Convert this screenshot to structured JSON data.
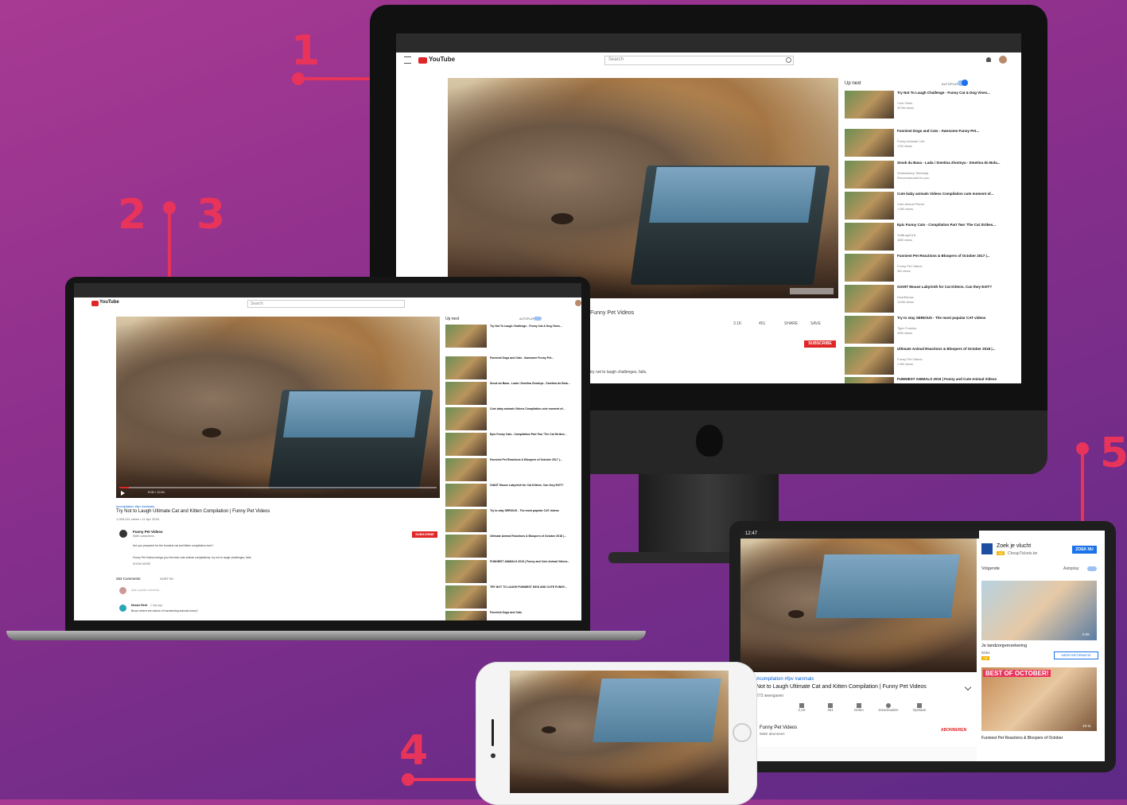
{
  "callouts": [
    {
      "number": "1"
    },
    {
      "number": "2"
    },
    {
      "number": "3"
    },
    {
      "number": "4"
    },
    {
      "number": "5"
    }
  ],
  "desktop": {
    "brand": "YouTube",
    "search_placeholder": "Search",
    "up_next_label": "Up next",
    "autoplay_label": "AUTOPLAY",
    "channel_name": "Funny Pet Videos",
    "subscribe_label": "SUBSCRIBE",
    "share_label": "SHARE",
    "save_label": "SAVE",
    "likes": "3.1K",
    "dislikes": "451",
    "description_snippet": "try not to laugh challenges, fails,",
    "up_next": [
      {
        "title": "Try Not To Laugh Challenge - Funny Cat & Dog Vines...",
        "channel": "Cool Vines",
        "views": "307M views"
      },
      {
        "title": "Funniest Dogs and Cats - Awesome Funny Pet...",
        "channel": "Funny Animals' Life",
        "views": "17M views"
      },
      {
        "title": "Smok du Basa - Lada i Smetina Zivotnya - Smetina do Bola...",
        "channel": "Smetankovy Televizija",
        "views": "Recommended for you"
      },
      {
        "title": "Cute baby animals Videos Compilation cute moment of...",
        "channel": "Cute Animal Planet",
        "views": "1.6M views"
      },
      {
        "title": "Epic Funny Cats - Compilation Part Two 'The Cat Strikes...",
        "channel": "VidBurg2018",
        "views": "18M views"
      },
      {
        "title": "Funniest Pet Reactions & Bloopers of October 2017 |...",
        "channel": "Funny Pet Videos",
        "views": "3M views"
      },
      {
        "title": "GIANT Mouse Labyrinth for Cat Kittens. Can they EXIT?",
        "channel": "DoorMouse",
        "views": "120M views"
      },
      {
        "title": "Try to stay SERIOUS - The most popular CAT videos",
        "channel": "Tiger Funnies",
        "views": "33M views"
      },
      {
        "title": "Ultimate Animal Reactions & Bloopers of October 2018 |...",
        "channel": "Funny Pet Videos",
        "views": "1.6M views"
      },
      {
        "title": "FUNNIEST ANIMALS 2019 | Funny and Cute Animal Videos",
        "channel": "",
        "views": ""
      }
    ]
  },
  "laptop": {
    "brand": "YouTube",
    "search_placeholder": "Search",
    "hashtags": "#compilation #fpv #animals",
    "video_title": "Try Not to Laugh Ultimate Cat and Kitten Compilation | Funny Pet Videos",
    "views_date": "1,099,241 views • 11 Apr 2018",
    "time": "0:00 / 12:01",
    "channel_name": "Funny Pet Videos",
    "subscribers": "566K subscribers",
    "subscribe_label": "SUBSCRIBE",
    "description_1": "Are you prepared for the funniest cat and kitten compilation ever?",
    "description_2": "Funny Pet Videos brings you the best cute animal compilations, try not to laugh challenges, fails,",
    "show_more": "SHOW MORE",
    "comments_count": "263 Comments",
    "sort_label": "SORT BY",
    "add_comment_placeholder": "Add a public comment...",
    "commenter": "Nessie Reid",
    "comment_time": "1 day ago",
    "comment_text": "Bruce where are videos of humanizing animals funny?",
    "up_next_label": "Up next",
    "autoplay_label": "AUTOPLAY",
    "up_next": [
      {
        "title": "Try Not To Laugh Challenge - Funny Cat & Dog Vines..."
      },
      {
        "title": "Funniest Dogs and Cats - Awesome Funny Pet..."
      },
      {
        "title": "Smok du Basa - Lada i Smetina Zivotnya - Smetina do Bola..."
      },
      {
        "title": "Cute baby animals Videos Compilation cute moment of..."
      },
      {
        "title": "Epic Funny Cats - Compilation Part Two 'The Cat Strikes..."
      },
      {
        "title": "Funniest Pet Reactions & Bloopers of October 2017 |..."
      },
      {
        "title": "GIANT Mouse Labyrinth for Cat Kittens. Can they EXIT?"
      },
      {
        "title": "Try to stay SERIOUS - The most popular CAT videos"
      },
      {
        "title": "Ultimate Animal Reactions & Bloopers of October 2018 |..."
      },
      {
        "title": "FUNNIEST ANIMALS 2019 | Funny and Cute Animal Videos..."
      },
      {
        "title": "TRY NOT TO LAUGH FUNNIEST KIDS AND CUTE FUNNY..."
      },
      {
        "title": "Funniest Dogs and Cats"
      }
    ]
  },
  "tablet": {
    "status_time": "12:47",
    "ad_title": "Zoek je vlucht",
    "ad_badge": "Ad",
    "ad_domain": "CheapTickets.be",
    "ad_button": "ZOEK NU",
    "next_label": "Volgende",
    "autoplay_label": "Autoplay",
    "ad2_title": "Je tandzorgverzekering",
    "ad2_advertiser": "Ikkbe",
    "ad2_badge": "Ad",
    "ad2_button": "MEER INFORMATIE",
    "ad2_duration": "0:36",
    "hashtags": "#compilation #fpv #animals",
    "video_title": "Not to Laugh Ultimate Cat and Kitten Compilation | Funny Pet Videos",
    "views": "273 weergaven",
    "actions": [
      {
        "label": "3,1K"
      },
      {
        "label": "451"
      },
      {
        "label": "Delen"
      },
      {
        "label": "Downloaden"
      },
      {
        "label": "Opslaan"
      }
    ],
    "channel_name": "Funny Pet Videos",
    "subscribers": "566K abonnees",
    "subscribe_label": "ABONNEREN",
    "rec_banner": "BEST OF OCTOBER!",
    "rec_title": "Funniest Pet Reactions & Bloopers of October",
    "rec_duration": "10:11"
  },
  "colors": {
    "accent": "#e8335a",
    "youtube_red": "#e02626",
    "link_blue": "#065fd4"
  }
}
